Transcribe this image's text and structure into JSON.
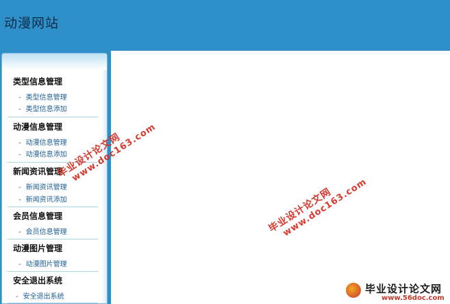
{
  "header": {
    "title": "动漫网站"
  },
  "sidebar": {
    "groups": [
      {
        "title": "类型信息管理",
        "items": [
          "类型信息管理",
          "类型信息添加"
        ]
      },
      {
        "title": "动漫信息管理",
        "items": [
          "动漫信息管理",
          "动漫信息添加"
        ]
      },
      {
        "title": "新闻资讯管理",
        "items": [
          "新闻资讯管理",
          "新闻资讯添加"
        ]
      },
      {
        "title": "会员信息管理",
        "items": [
          "会员信息管理"
        ]
      },
      {
        "title": "动漫图片管理",
        "items": [
          "动漫图片管理"
        ]
      },
      {
        "title": "安全退出系统",
        "items": [
          "安全退出系统"
        ]
      }
    ],
    "dash": "-"
  },
  "watermark": {
    "cn": "毕业设计论文网",
    "url": "www.doc163.com"
  },
  "brand": {
    "name": "毕业设计论文网",
    "url": "www.56doc.com"
  },
  "colors": {
    "header_bg": "#2f8fc8",
    "link": "#1d5e95",
    "watermark": "#d42a1e"
  }
}
